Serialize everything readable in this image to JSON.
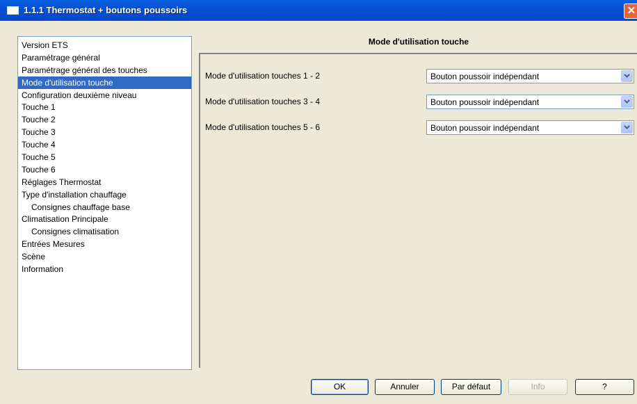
{
  "window": {
    "title": "1.1.1 Thermostat + boutons poussoirs",
    "close_glyph": "✕"
  },
  "tree": {
    "items": [
      {
        "label": "Version ETS"
      },
      {
        "label": "Paramétrage général"
      },
      {
        "label": "Paramétrage général des touches"
      },
      {
        "label": "Mode d'utilisation touche",
        "selected": true
      },
      {
        "label": "Configuration deuxième niveau"
      },
      {
        "label": "Touche 1"
      },
      {
        "label": "Touche 2"
      },
      {
        "label": "Touche 3"
      },
      {
        "label": "Touche 4"
      },
      {
        "label": "Touche 5"
      },
      {
        "label": "Touche 6"
      },
      {
        "label": "Réglages Thermostat"
      },
      {
        "label": "Type d'installation chauffage"
      },
      {
        "label": "Consignes chauffage base",
        "indent": true
      },
      {
        "label": "Climatisation Principale"
      },
      {
        "label": "Consignes climatisation",
        "indent": true
      },
      {
        "label": "Entrées Mesures"
      },
      {
        "label": "Scène"
      },
      {
        "label": "Information"
      }
    ]
  },
  "panel": {
    "header": "Mode d'utilisation touche",
    "rows": [
      {
        "label": "Mode d'utilisation touches 1 - 2",
        "value": "Bouton poussoir indépendant"
      },
      {
        "label": "Mode d'utilisation touches 3 - 4",
        "value": "Bouton poussoir indépendant"
      },
      {
        "label": "Mode d'utilisation touches 5 - 6",
        "value": "Bouton poussoir indépendant"
      }
    ]
  },
  "buttons": {
    "ok": "OK",
    "cancel": "Annuler",
    "default": "Par défaut",
    "info": "Info",
    "help": "?"
  },
  "icons": {
    "app": "window-icon",
    "close": "close-icon",
    "dropdown": "chevron-down-icon"
  },
  "colors": {
    "titlebar": "#0450d6",
    "selection": "#316ac5",
    "background": "#ece9d8",
    "close": "#e5633d"
  }
}
